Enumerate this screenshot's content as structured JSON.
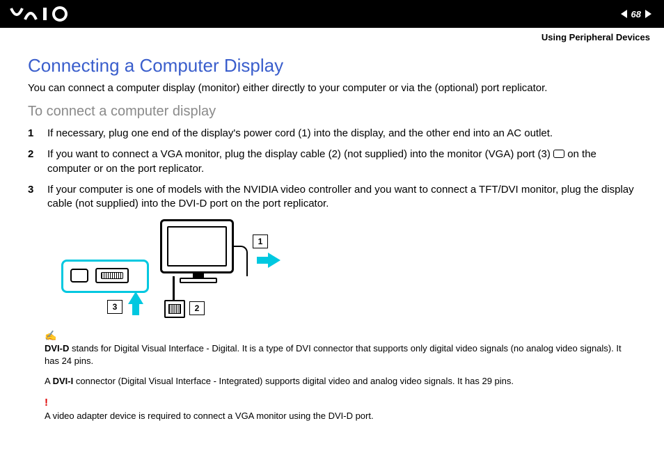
{
  "header": {
    "logo_alt": "VAIO",
    "page_number": "68",
    "breadcrumb": "Using Peripheral Devices"
  },
  "title": "Connecting a Computer Display",
  "intro": "You can connect a computer display (monitor) either directly to your computer or via the (optional) port replicator.",
  "subhead": "To connect a computer display",
  "steps": [
    {
      "n": "1",
      "text": "If necessary, plug one end of the display's power cord (1) into the display, and the other end into an AC outlet."
    },
    {
      "n": "2",
      "pre": "If you want to connect a VGA monitor, plug the display cable (2) (not supplied) into the monitor (VGA) port (3) ",
      "post": " on the computer or on the port replicator."
    },
    {
      "n": "3",
      "text": "If your computer is one of  models with the NVIDIA video controller and you want to connect a TFT/DVI monitor, plug the display cable (not supplied) into the DVI-D port on the port replicator."
    }
  ],
  "diagram": {
    "label1": "1",
    "label2": "2",
    "label3": "3"
  },
  "notes": {
    "pencil_icon": "✍",
    "dvi_d_label": "DVI-D",
    "dvi_d_text": " stands for Digital Visual Interface - Digital. It is a type of DVI connector that supports only digital video signals (no analog video signals). It has 24 pins.",
    "dvi_i_pre": "A ",
    "dvi_i_label": "DVI-I",
    "dvi_i_text": " connector (Digital Visual Interface - Integrated) supports digital video and analog video signals. It has 29 pins.",
    "warn_icon": "!",
    "warn_text": "A video adapter device is required to connect a VGA monitor using the DVI-D port."
  }
}
